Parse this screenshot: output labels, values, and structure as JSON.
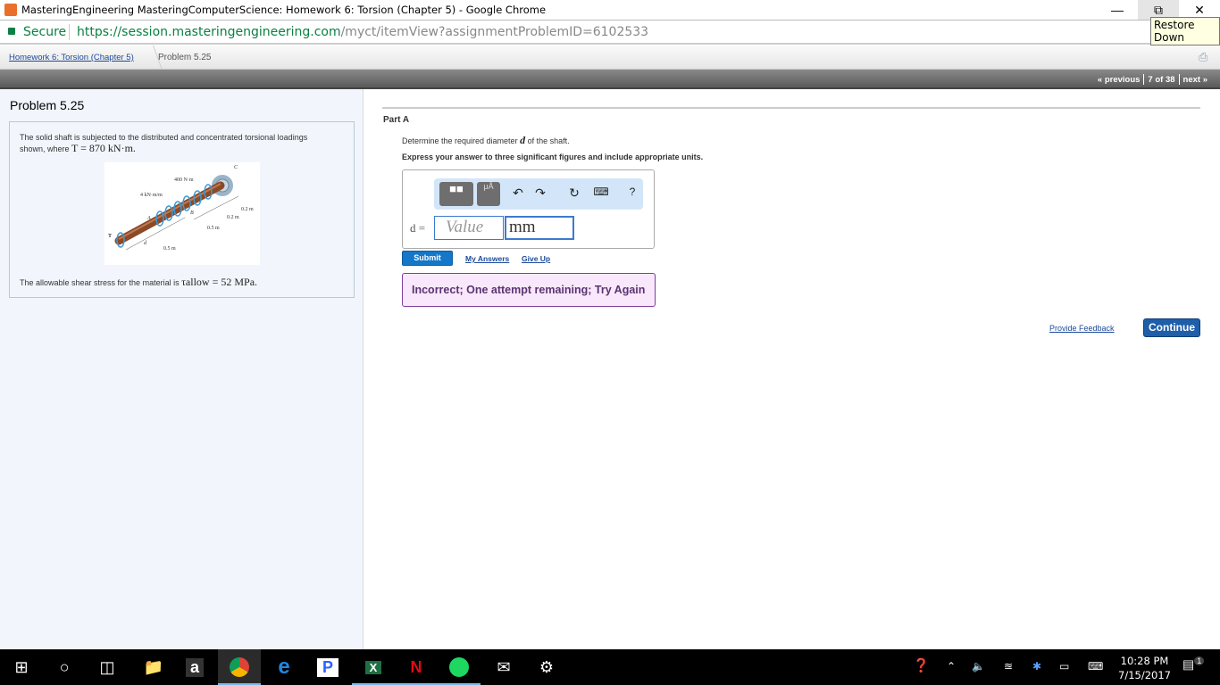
{
  "window": {
    "title": "MasteringEngineering MasteringComputerScience: Homework 6: Torsion (Chapter 5) - Google Chrome",
    "tooltip": "Restore Down"
  },
  "address": {
    "secure_label": "Secure",
    "url_host": "https://session.masteringengineering.com",
    "url_path": "/myct/itemView?assignmentProblemID=6102533"
  },
  "breadcrumb": {
    "parent": "Homework 6: Torsion (Chapter 5)",
    "current": "Problem 5.25"
  },
  "pager": {
    "previous": "« previous",
    "position": "7 of 38",
    "next": "next »"
  },
  "problem": {
    "title": "Problem 5.25",
    "intro": "The solid shaft is subjected to the distributed and concentrated torsional loadings shown, where",
    "torque_math": "T = 870 kN·m.",
    "allowable_text": "The allowable shear stress for the material is",
    "allowable_math": "τallow = 52 MPa.",
    "figure_labels": {
      "c": "C",
      "moment": "400 N·m",
      "dist": "4 kN·m/m",
      "a": "A",
      "b": "B",
      "t": "T",
      "d": "d",
      "l1": "0.2 m",
      "l2": "0.2 m",
      "l3": "0.5 m",
      "l4": "0.5 m"
    }
  },
  "part": {
    "label": "Part A",
    "question_pre": "Determine the required diameter",
    "question_var": "d",
    "question_post": "of the shaft.",
    "instruction": "Express your answer to three significant figures and include appropriate units.",
    "var_label": "d =",
    "value_placeholder": "Value",
    "unit_value": "mm",
    "units_btn": "μÅ",
    "help": "?",
    "submit": "Submit",
    "my_answers": "My Answers",
    "give_up": "Give Up",
    "feedback": "Incorrect; One attempt remaining; Try Again"
  },
  "footer": {
    "provide_feedback": "Provide Feedback",
    "continue": "Continue"
  },
  "taskbar": {
    "time": "10:28 PM",
    "date": "7/15/2017",
    "notifications": "1",
    "apps": [
      "windows-start",
      "cortana",
      "task-view",
      "file-explorer",
      "amazon",
      "chrome",
      "edge",
      "pandora",
      "excel",
      "netflix",
      "spotify",
      "mail",
      "settings"
    ]
  },
  "colors": {
    "accent": "#1477c8",
    "feedback_bg": "#f9e8fc",
    "feedback_border": "#7a3e9a",
    "secure": "#0b8043"
  }
}
